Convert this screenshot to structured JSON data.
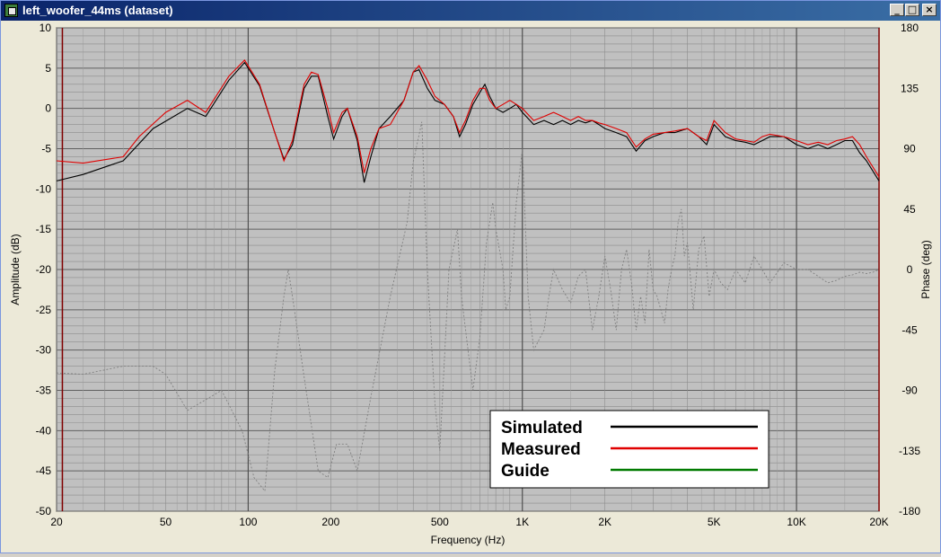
{
  "window": {
    "title": "left_woofer_44ms (dataset)",
    "minimize_glyph": "_",
    "maximize_glyph": "□",
    "close_glyph": "×"
  },
  "colors": {
    "plot_bg": "#c0c0c0",
    "simulated": "#000000",
    "measured": "#e00000",
    "guide": "#007a00",
    "phase": "#808080",
    "boundary": "#800000"
  },
  "chart_data": {
    "type": "line",
    "x_scale": "log",
    "xlim": [
      20,
      20000
    ],
    "ylim": [
      -50,
      10
    ],
    "y2lim": [
      -180,
      180
    ],
    "xlabel": "Frequency (Hz)",
    "ylabel": "Amplitude (dB)",
    "y2label": "Phase (deg)",
    "grid": true,
    "legend_position": "bottom-right",
    "x_ticks": [
      {
        "v": 20,
        "label": "20"
      },
      {
        "v": 50,
        "label": "50"
      },
      {
        "v": 100,
        "label": "100"
      },
      {
        "v": 200,
        "label": "200"
      },
      {
        "v": 500,
        "label": "500"
      },
      {
        "v": 1000,
        "label": "1K"
      },
      {
        "v": 2000,
        "label": "2K"
      },
      {
        "v": 5000,
        "label": "5K"
      },
      {
        "v": 10000,
        "label": "10K"
      },
      {
        "v": 20000,
        "label": "20K"
      }
    ],
    "y_ticks": [
      {
        "v": 10,
        "label": "10"
      },
      {
        "v": 5,
        "label": "5"
      },
      {
        "v": 0,
        "label": "0"
      },
      {
        "v": -5,
        "label": "-5"
      },
      {
        "v": -10,
        "label": "-10"
      },
      {
        "v": -15,
        "label": "-15"
      },
      {
        "v": -20,
        "label": "-20"
      },
      {
        "v": -25,
        "label": "-25"
      },
      {
        "v": -30,
        "label": "-30"
      },
      {
        "v": -35,
        "label": "-35"
      },
      {
        "v": -40,
        "label": "-40"
      },
      {
        "v": -45,
        "label": "-45"
      },
      {
        "v": -50,
        "label": "-50"
      }
    ],
    "y2_ticks": [
      {
        "v": 180,
        "label": "180"
      },
      {
        "v": 135,
        "label": "135"
      },
      {
        "v": 90,
        "label": "90"
      },
      {
        "v": 45,
        "label": "45"
      },
      {
        "v": 0,
        "label": "0"
      },
      {
        "v": -45,
        "label": "-45"
      },
      {
        "v": -90,
        "label": "-90"
      },
      {
        "v": -135,
        "label": "-135"
      },
      {
        "v": -180,
        "label": "-180"
      }
    ],
    "boundary_lines": [
      21,
      20000
    ],
    "legend": [
      {
        "name": "Simulated",
        "color": "#000000"
      },
      {
        "name": "Measured",
        "color": "#e00000"
      },
      {
        "name": "Guide",
        "color": "#007a00"
      }
    ],
    "series": [
      {
        "name": "Simulated",
        "color": "#000000",
        "axis": "left",
        "points": [
          [
            20,
            -9
          ],
          [
            25,
            -8.2
          ],
          [
            35,
            -6.5
          ],
          [
            45,
            -2.5
          ],
          [
            60,
            0
          ],
          [
            70,
            -1
          ],
          [
            85,
            3.5
          ],
          [
            97,
            5.7
          ],
          [
            110,
            2.8
          ],
          [
            125,
            -3
          ],
          [
            135,
            -6.3
          ],
          [
            145,
            -4.5
          ],
          [
            160,
            2.5
          ],
          [
            170,
            4
          ],
          [
            180,
            4
          ],
          [
            195,
            -1
          ],
          [
            205,
            -3.8
          ],
          [
            220,
            -1
          ],
          [
            230,
            0
          ],
          [
            250,
            -4
          ],
          [
            265,
            -9.2
          ],
          [
            280,
            -6
          ],
          [
            300,
            -2.5
          ],
          [
            330,
            -1
          ],
          [
            370,
            1
          ],
          [
            400,
            4.5
          ],
          [
            420,
            4.8
          ],
          [
            450,
            2.5
          ],
          [
            480,
            1
          ],
          [
            520,
            0.5
          ],
          [
            560,
            -1
          ],
          [
            590,
            -3.5
          ],
          [
            620,
            -2
          ],
          [
            660,
            0.5
          ],
          [
            700,
            2
          ],
          [
            730,
            3
          ],
          [
            760,
            1.5
          ],
          [
            800,
            0
          ],
          [
            850,
            -0.5
          ],
          [
            900,
            0
          ],
          [
            950,
            0.5
          ],
          [
            1000,
            -0.5
          ],
          [
            1100,
            -2
          ],
          [
            1200,
            -1.5
          ],
          [
            1300,
            -2
          ],
          [
            1400,
            -1.5
          ],
          [
            1500,
            -2
          ],
          [
            1600,
            -1.5
          ],
          [
            1700,
            -1.8
          ],
          [
            1800,
            -1.5
          ],
          [
            1900,
            -2
          ],
          [
            2000,
            -2.5
          ],
          [
            2200,
            -3
          ],
          [
            2400,
            -3.5
          ],
          [
            2600,
            -5.3
          ],
          [
            2800,
            -4
          ],
          [
            3000,
            -3.5
          ],
          [
            3300,
            -3
          ],
          [
            3600,
            -3
          ],
          [
            4000,
            -2.5
          ],
          [
            4400,
            -3.5
          ],
          [
            4700,
            -4.5
          ],
          [
            5000,
            -2
          ],
          [
            5500,
            -3.5
          ],
          [
            6000,
            -4
          ],
          [
            6500,
            -4.2
          ],
          [
            7000,
            -4.5
          ],
          [
            7500,
            -4
          ],
          [
            8000,
            -3.5
          ],
          [
            9000,
            -3.5
          ],
          [
            10000,
            -4.5
          ],
          [
            11000,
            -5
          ],
          [
            12000,
            -4.5
          ],
          [
            13000,
            -5
          ],
          [
            14000,
            -4.5
          ],
          [
            15000,
            -4
          ],
          [
            16000,
            -4
          ],
          [
            17000,
            -5.5
          ],
          [
            18000,
            -6.5
          ],
          [
            20000,
            -9
          ]
        ]
      },
      {
        "name": "Measured",
        "color": "#e00000",
        "axis": "left",
        "points": [
          [
            20,
            -6.5
          ],
          [
            25,
            -6.8
          ],
          [
            35,
            -6
          ],
          [
            40,
            -3.5
          ],
          [
            50,
            -0.5
          ],
          [
            60,
            1
          ],
          [
            70,
            -0.5
          ],
          [
            85,
            4
          ],
          [
            97,
            6
          ],
          [
            110,
            3
          ],
          [
            125,
            -3
          ],
          [
            135,
            -6.5
          ],
          [
            145,
            -4
          ],
          [
            160,
            3
          ],
          [
            170,
            4.5
          ],
          [
            180,
            4.2
          ],
          [
            195,
            0
          ],
          [
            205,
            -3
          ],
          [
            220,
            -0.5
          ],
          [
            230,
            0
          ],
          [
            250,
            -3.5
          ],
          [
            265,
            -8
          ],
          [
            280,
            -5
          ],
          [
            300,
            -2.5
          ],
          [
            330,
            -2
          ],
          [
            370,
            1
          ],
          [
            400,
            4.5
          ],
          [
            420,
            5.3
          ],
          [
            450,
            3.5
          ],
          [
            480,
            1.5
          ],
          [
            520,
            0.5
          ],
          [
            560,
            -1
          ],
          [
            590,
            -3
          ],
          [
            620,
            -1.5
          ],
          [
            660,
            1
          ],
          [
            700,
            2.5
          ],
          [
            730,
            2.5
          ],
          [
            760,
            1
          ],
          [
            800,
            0
          ],
          [
            850,
            0.5
          ],
          [
            900,
            1
          ],
          [
            950,
            0.5
          ],
          [
            1000,
            0
          ],
          [
            1100,
            -1.5
          ],
          [
            1200,
            -1
          ],
          [
            1300,
            -0.5
          ],
          [
            1400,
            -1
          ],
          [
            1500,
            -1.5
          ],
          [
            1600,
            -1
          ],
          [
            1700,
            -1.5
          ],
          [
            1800,
            -1.5
          ],
          [
            1900,
            -1.8
          ],
          [
            2000,
            -2
          ],
          [
            2200,
            -2.5
          ],
          [
            2400,
            -3
          ],
          [
            2600,
            -4.8
          ],
          [
            2800,
            -3.8
          ],
          [
            3000,
            -3.2
          ],
          [
            3300,
            -3
          ],
          [
            3600,
            -2.8
          ],
          [
            4000,
            -2.5
          ],
          [
            4400,
            -3.5
          ],
          [
            4700,
            -4
          ],
          [
            5000,
            -1.5
          ],
          [
            5500,
            -3
          ],
          [
            6000,
            -3.8
          ],
          [
            6500,
            -4
          ],
          [
            7000,
            -4.2
          ],
          [
            7500,
            -3.5
          ],
          [
            8000,
            -3.2
          ],
          [
            9000,
            -3.5
          ],
          [
            10000,
            -4
          ],
          [
            11000,
            -4.5
          ],
          [
            12000,
            -4.2
          ],
          [
            13000,
            -4.5
          ],
          [
            14000,
            -4
          ],
          [
            15000,
            -3.8
          ],
          [
            16000,
            -3.5
          ],
          [
            17000,
            -4.5
          ],
          [
            18000,
            -6
          ],
          [
            20000,
            -8.5
          ]
        ]
      },
      {
        "name": "Phase",
        "color": "#808080",
        "axis": "right",
        "dashed": true,
        "points": [
          [
            20,
            -77
          ],
          [
            25,
            -78
          ],
          [
            35,
            -72
          ],
          [
            45,
            -72
          ],
          [
            50,
            -78
          ],
          [
            60,
            -105
          ],
          [
            80,
            -90
          ],
          [
            95,
            -120
          ],
          [
            105,
            -155
          ],
          [
            115,
            -165
          ],
          [
            125,
            -75
          ],
          [
            135,
            -20
          ],
          [
            140,
            0
          ],
          [
            145,
            -20
          ],
          [
            160,
            -80
          ],
          [
            180,
            -150
          ],
          [
            195,
            -155
          ],
          [
            210,
            -130
          ],
          [
            230,
            -130
          ],
          [
            250,
            -150
          ],
          [
            280,
            -95
          ],
          [
            330,
            -20
          ],
          [
            380,
            35
          ],
          [
            400,
            80
          ],
          [
            430,
            110
          ],
          [
            450,
            0
          ],
          [
            480,
            -100
          ],
          [
            500,
            -135
          ],
          [
            540,
            0
          ],
          [
            580,
            30
          ],
          [
            600,
            -20
          ],
          [
            660,
            -90
          ],
          [
            700,
            -50
          ],
          [
            740,
            20
          ],
          [
            780,
            50
          ],
          [
            800,
            30
          ],
          [
            850,
            0
          ],
          [
            870,
            -30
          ],
          [
            900,
            -20
          ],
          [
            950,
            50
          ],
          [
            1000,
            90
          ],
          [
            1050,
            -20
          ],
          [
            1100,
            -60
          ],
          [
            1200,
            -45
          ],
          [
            1250,
            -20
          ],
          [
            1300,
            0
          ],
          [
            1400,
            -15
          ],
          [
            1500,
            -25
          ],
          [
            1600,
            -5
          ],
          [
            1700,
            0
          ],
          [
            1800,
            -45
          ],
          [
            1900,
            -20
          ],
          [
            2000,
            10
          ],
          [
            2100,
            -15
          ],
          [
            2200,
            -45
          ],
          [
            2300,
            0
          ],
          [
            2400,
            15
          ],
          [
            2500,
            -10
          ],
          [
            2600,
            -45
          ],
          [
            2700,
            -20
          ],
          [
            2800,
            -40
          ],
          [
            2900,
            15
          ],
          [
            3000,
            -15
          ],
          [
            3100,
            -20
          ],
          [
            3200,
            -30
          ],
          [
            3300,
            -40
          ],
          [
            3400,
            -15
          ],
          [
            3500,
            0
          ],
          [
            3600,
            10
          ],
          [
            3700,
            35
          ],
          [
            3800,
            45
          ],
          [
            3900,
            10
          ],
          [
            4000,
            20
          ],
          [
            4200,
            -30
          ],
          [
            4400,
            15
          ],
          [
            4600,
            25
          ],
          [
            4800,
            -20
          ],
          [
            5000,
            0
          ],
          [
            5300,
            -10
          ],
          [
            5600,
            -15
          ],
          [
            6000,
            0
          ],
          [
            6500,
            -10
          ],
          [
            7000,
            10
          ],
          [
            7500,
            0
          ],
          [
            8000,
            -10
          ],
          [
            9000,
            5
          ],
          [
            10000,
            0
          ],
          [
            11000,
            0
          ],
          [
            12000,
            -5
          ],
          [
            13000,
            -10
          ],
          [
            14000,
            -8
          ],
          [
            15000,
            -5
          ],
          [
            16000,
            -4
          ],
          [
            17000,
            -2
          ],
          [
            18000,
            -3
          ],
          [
            19000,
            -2
          ],
          [
            20000,
            0
          ]
        ]
      },
      {
        "name": "Guide",
        "color": "#007a00",
        "axis": "left",
        "points": []
      }
    ]
  }
}
